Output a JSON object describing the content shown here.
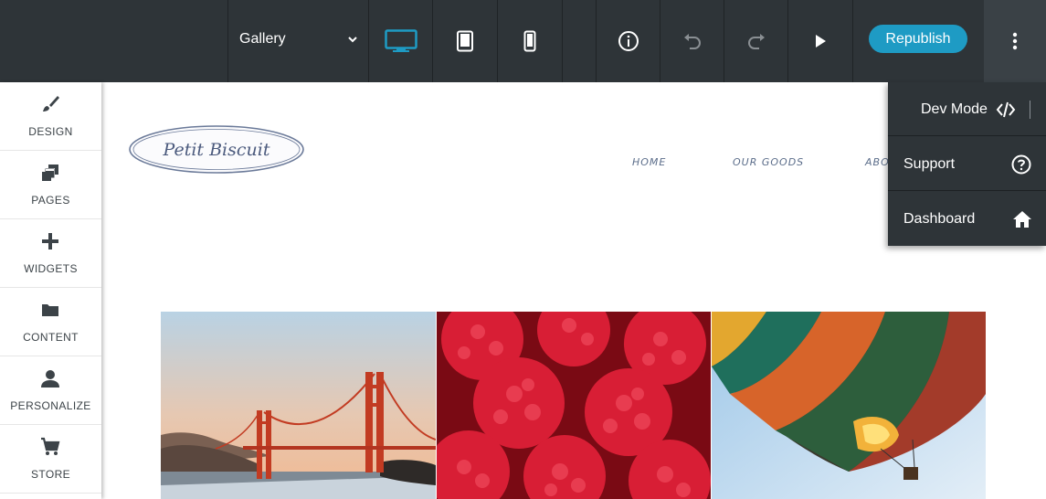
{
  "toolbar": {
    "page_selector": {
      "value": "Gallery"
    },
    "device_views": [
      {
        "name": "desktop",
        "icon": "desktop-icon",
        "active": true
      },
      {
        "name": "tablet",
        "icon": "tablet-icon",
        "active": false
      },
      {
        "name": "mobile",
        "icon": "mobile-icon",
        "active": false
      }
    ],
    "info_icon": "info-icon",
    "undo_icon": "undo-icon",
    "redo_icon": "redo-icon",
    "preview_icon": "play-icon",
    "republish_label": "Republish",
    "more_icon": "vertical-dots-icon",
    "accent_color": "#1e9bc4"
  },
  "sidebar": {
    "items": [
      {
        "label": "DESIGN",
        "icon": "brush-icon"
      },
      {
        "label": "PAGES",
        "icon": "pages-icon"
      },
      {
        "label": "WIDGETS",
        "icon": "plus-icon"
      },
      {
        "label": "CONTENT",
        "icon": "folder-icon"
      },
      {
        "label": "PERSONALIZE",
        "icon": "person-icon"
      },
      {
        "label": "STORE",
        "icon": "cart-icon"
      }
    ]
  },
  "site": {
    "logo_text": "Petit Biscuit",
    "nav": [
      "HOME",
      "OUR GOODS",
      "ABO"
    ],
    "gallery": [
      {
        "alt": "bridge-photo"
      },
      {
        "alt": "raspberries-photo"
      },
      {
        "alt": "hot-air-balloon-photo"
      }
    ]
  },
  "menu": {
    "items": [
      {
        "label": "Dev Mode",
        "icon": "code-icon"
      },
      {
        "label": "Support",
        "icon": "help-circle-icon"
      },
      {
        "label": "Dashboard",
        "icon": "home-icon"
      }
    ]
  }
}
